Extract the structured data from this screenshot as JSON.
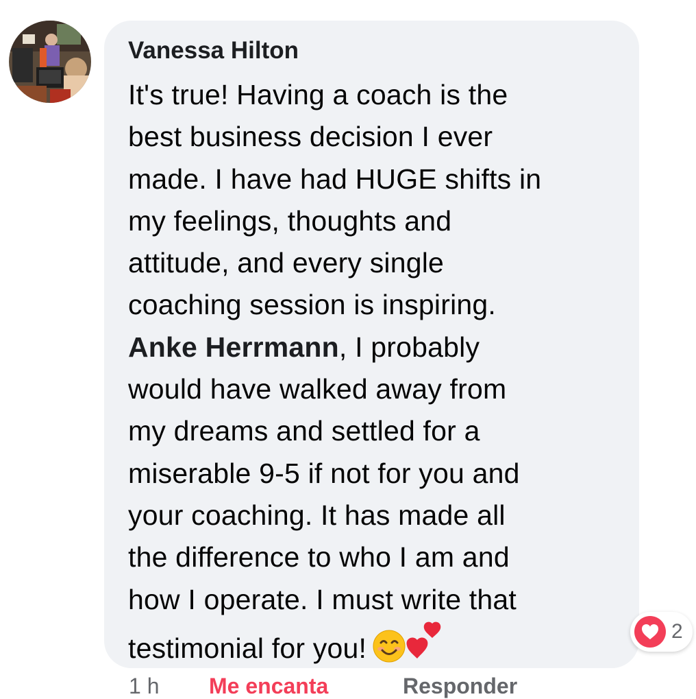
{
  "comment": {
    "author": "Vanessa Hilton",
    "lines": [
      "It's true! Having a coach is the",
      "best business decision I ever",
      "made. I have had HUGE shifts in",
      "my feelings, thoughts and",
      "attitude, and every single",
      "coaching session is inspiring."
    ],
    "mention": "Anke Herrmann",
    "mention_suffix": ", I probably",
    "lines_after": [
      "would have walked away from",
      "my dreams and settled for a",
      "miserable 9-5 if not for you and",
      "your coaching. It has made all",
      "the difference to who I am and",
      "how I operate. I must write that"
    ],
    "last_line": "testimonial for you!",
    "emojis": [
      "smiling-face-emoji",
      "two-hearts-emoji"
    ]
  },
  "reactions": {
    "icon": "love-reaction-icon",
    "count": "2",
    "color": "#f33e58"
  },
  "actions": {
    "time": "1 h",
    "react": "Me encanta",
    "reply": "Responder"
  },
  "colors": {
    "bubble": "#f0f2f5",
    "text": "#050505",
    "secondary": "#65676b",
    "love": "#f33e58"
  }
}
